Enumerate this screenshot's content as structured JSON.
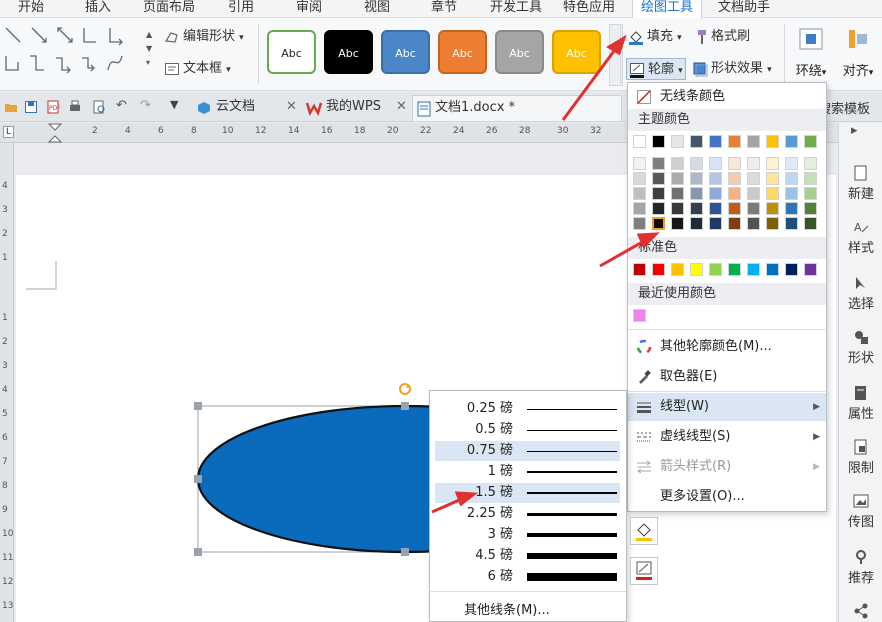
{
  "menu_tabs": [
    "开始",
    "插入",
    "页面布局",
    "引用",
    "审阅",
    "视图",
    "章节",
    "开发工具",
    "特色应用",
    "绘图工具",
    "文档助手"
  ],
  "ribbon": {
    "edit_shape": "编辑形状",
    "text_box": "文本框",
    "styles": [
      {
        "label": "Abc",
        "bg": "#ffffff",
        "fg": "#222222",
        "border": "#6aa84f"
      },
      {
        "label": "Abc",
        "bg": "#000000",
        "fg": "#ffffff",
        "border": "#000000"
      },
      {
        "label": "Abc",
        "bg": "#4a86c8",
        "fg": "#ffffff",
        "border": "#3b6fa8"
      },
      {
        "label": "Abc",
        "bg": "#ed7d31",
        "fg": "#ffffff",
        "border": "#c4651f"
      },
      {
        "label": "Abc",
        "bg": "#a5a5a5",
        "fg": "#ffffff",
        "border": "#8a8a8a"
      },
      {
        "label": "Abc",
        "bg": "#ffc000",
        "fg": "#ffffff",
        "border": "#d9a300"
      }
    ],
    "fill": "填充",
    "format_painter": "格式刷",
    "outline": "轮廓",
    "shape_effects": "形状效果",
    "wrap": "环绕",
    "align": "对齐"
  },
  "doc_tabs": {
    "cloud": "云文档",
    "wps": "我的WPS",
    "doc": "文档1.docx *",
    "search_template": "搜索模板"
  },
  "ruler_numbers": [
    "2",
    "4",
    "6",
    "8",
    "10",
    "12",
    "14",
    "16",
    "18",
    "20",
    "22",
    "24",
    "26",
    "28",
    "30",
    "32"
  ],
  "vruler_numbers": [
    "4",
    "3",
    "2",
    "1",
    "1",
    "2",
    "3",
    "4",
    "5",
    "6",
    "7",
    "8",
    "9",
    "10",
    "11",
    "12",
    "13"
  ],
  "right_pane": [
    "新建",
    "样式",
    "选择",
    "形状",
    "属性",
    "限制",
    "传图",
    "推荐"
  ],
  "color_menu": {
    "no_line": "无线条颜色",
    "theme_colors": "主题颜色",
    "standard_colors": "标准色",
    "recent_colors": "最近使用颜色",
    "more_colors": "其他轮廓颜色(M)...",
    "eyedropper": "取色器(E)",
    "line_style": "线型(W)",
    "dash_style": "虚线线型(S)",
    "arrow_style": "箭头样式(R)",
    "more_settings": "更多设置(O)...",
    "theme_top_row": [
      "#ffffff",
      "#000000",
      "#e7e6e6",
      "#44546a",
      "#4472c4",
      "#ed7d31",
      "#a5a5a5",
      "#ffc000",
      "#5b9bd5",
      "#70ad47"
    ],
    "theme_shades": [
      [
        "#f2f2f2",
        "#7f7f7f",
        "#d0cece",
        "#d6dce4",
        "#d9e2f3",
        "#fbe5d5",
        "#ededed",
        "#fff2cc",
        "#deeaf6",
        "#e2efd9"
      ],
      [
        "#d8d8d8",
        "#595959",
        "#aeaaaa",
        "#adb9ca",
        "#b4c6e7",
        "#f7cbac",
        "#dbdbdb",
        "#ffe598",
        "#bdd7ee",
        "#c5e0b3"
      ],
      [
        "#bfbfbf",
        "#3f3f3f",
        "#757070",
        "#8496b0",
        "#8eaadb",
        "#f4b183",
        "#c9c9c9",
        "#ffd965",
        "#9cc3e5",
        "#a8d08d"
      ],
      [
        "#a5a5a5",
        "#262626",
        "#3a3838",
        "#323f4f",
        "#2f5496",
        "#c55a11",
        "#7b7b7b",
        "#bf9000",
        "#2e75b5",
        "#538135"
      ],
      [
        "#7f7f7f",
        "#0c0c0c",
        "#171616",
        "#222a35",
        "#1f3864",
        "#833c0b",
        "#525252",
        "#7f6000",
        "#1e4e79",
        "#375623"
      ]
    ],
    "standard": [
      "#c00000",
      "#ff0000",
      "#ffc000",
      "#ffff00",
      "#92d050",
      "#00b050",
      "#00b0f0",
      "#0070c0",
      "#002060",
      "#7030a0"
    ],
    "recent": [
      "#ee82ee"
    ]
  },
  "line_weights": [
    {
      "label": "0.25 磅",
      "w": 1
    },
    {
      "label": "0.5 磅",
      "w": 1
    },
    {
      "label": "0.75 磅",
      "w": 1
    },
    {
      "label": "1 磅",
      "w": 2
    },
    {
      "label": "1.5 磅",
      "w": 2
    },
    {
      "label": "2.25 磅",
      "w": 3
    },
    {
      "label": "3 磅",
      "w": 4
    },
    {
      "label": "4.5 磅",
      "w": 6
    },
    {
      "label": "6 磅",
      "w": 8
    }
  ],
  "line_more": "其他线条(M)...",
  "shape_fill_color": "#0a6bbd",
  "annotation_color": "#e03030"
}
